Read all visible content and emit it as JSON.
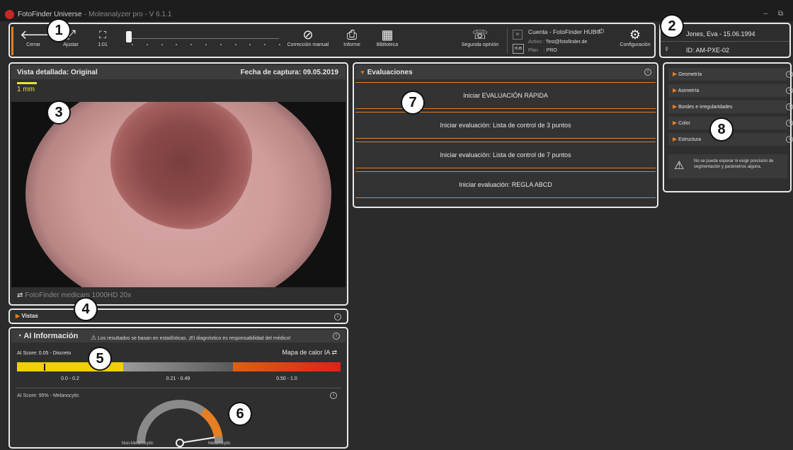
{
  "window": {
    "title": "FotoFinder Universe",
    "subtitle": "- Moleanalyzer pro - V 6.1.1",
    "controls": "– ⧉"
  },
  "toolbar": {
    "close": "Cerrar",
    "fit": "Ajustar",
    "one_to_one": "1:01",
    "manual_correction": "Corrección manual",
    "report": "Informe",
    "library": "Biblioteca",
    "second_opinion": "Segunda opinión",
    "settings": "Configuración",
    "account": {
      "ai_badge": "AI",
      "hub_badge": "HUB",
      "title": "Cuenta - FotoFinder HUB®",
      "active_label": "Activo",
      "active_value": "Test@fotofinder.de",
      "plan_label": "Plan",
      "plan_value": "PRO"
    }
  },
  "patient": {
    "name": "Jones, Eva - 15.06.1994",
    "id": "ID: AM-PXE-02"
  },
  "viewer": {
    "title": "Vista detallada: Original",
    "capture_date": "Fecha de captura: 09.05.2019",
    "scale_label": "1 mm",
    "device": "FotoFinder medicam 1000HD 20x"
  },
  "views": {
    "label": "Vistas"
  },
  "ai": {
    "title": "AI Información",
    "warning": "Los resultados se basan en estadísticas. ¡El diagnóstico es responsabilidad del médico!",
    "score_label": "AI Score: 0.05 - Discreto",
    "heatmap": "Mapa de calor IA",
    "ranges": [
      "0.0 - 0.2",
      "0.21 - 0.49",
      "0.50 - 1.0"
    ],
    "score_value": 0.05,
    "melanocytic_label": "AI Score: 95% - Melanocytic",
    "melanocytic_percent": 95,
    "gauge_left": "Non-Melanocytic",
    "gauge_right": "Melanocytic",
    "colors": {
      "low": "#f0d000",
      "mid": "#777777",
      "high": "#e0321a",
      "gauge": "#e67e22"
    }
  },
  "evaluations": {
    "title": "Evaluaciones",
    "items": [
      "Iniciar EVALUACIÓN RÁPIDA",
      "Iniciar evaluación: Lista de control de 3 puntos",
      "Iniciar evaluación: Lista de control de 7 puntos",
      "Iniciar evaluación: REGLA ABCD"
    ]
  },
  "right_panel": {
    "items": [
      "Geometría",
      "Asimetría",
      "Bordes e irregularidades",
      "Color",
      "Estructura"
    ],
    "warning": "No se puede esperar ni exigir precisión de segmentación y parámetros alguna."
  },
  "callouts": [
    "1",
    "2",
    "3",
    "4",
    "5",
    "6",
    "7",
    "8"
  ],
  "accent_color": "#e67e22"
}
